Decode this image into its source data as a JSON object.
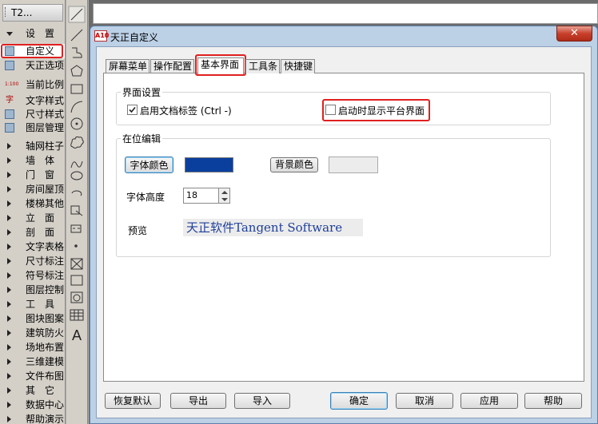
{
  "left_panel": {
    "title": "T2...",
    "items": [
      {
        "label": "设　置",
        "kind": "arrow-down",
        "icon": "expand-arrow-icon"
      },
      {
        "label": "自定义",
        "kind": "icon",
        "icon": "customize-pen-icon",
        "selected": true
      },
      {
        "label": "天正选项",
        "kind": "icon",
        "icon": "options-icon"
      },
      {
        "label": "当前比例",
        "kind": "icon",
        "icon": "scale-1-100-icon",
        "icon_text": "1:100"
      },
      {
        "label": "文字样式",
        "kind": "icon",
        "icon": "text-style-icon",
        "icon_text": "字"
      },
      {
        "label": "尺寸样式",
        "kind": "icon",
        "icon": "dimension-style-icon"
      },
      {
        "label": "图层管理",
        "kind": "icon",
        "icon": "layer-manager-icon"
      },
      {
        "label": "轴网柱子",
        "kind": "arrow"
      },
      {
        "label": "墙　体",
        "kind": "arrow"
      },
      {
        "label": "门　窗",
        "kind": "arrow"
      },
      {
        "label": "房间屋顶",
        "kind": "arrow"
      },
      {
        "label": "楼梯其他",
        "kind": "arrow"
      },
      {
        "label": "立　面",
        "kind": "arrow"
      },
      {
        "label": "剖　面",
        "kind": "arrow"
      },
      {
        "label": "文字表格",
        "kind": "arrow"
      },
      {
        "label": "尺寸标注",
        "kind": "arrow"
      },
      {
        "label": "符号标注",
        "kind": "arrow"
      },
      {
        "label": "图层控制",
        "kind": "arrow"
      },
      {
        "label": "工　具",
        "kind": "arrow"
      },
      {
        "label": "图块图案",
        "kind": "arrow"
      },
      {
        "label": "建筑防火",
        "kind": "arrow"
      },
      {
        "label": "场地布置",
        "kind": "arrow"
      },
      {
        "label": "三维建模",
        "kind": "arrow"
      },
      {
        "label": "文件布图",
        "kind": "arrow"
      },
      {
        "label": "其　它",
        "kind": "arrow"
      },
      {
        "label": "数据中心",
        "kind": "arrow"
      },
      {
        "label": "帮助演示",
        "kind": "arrow"
      }
    ]
  },
  "toolstrip": {
    "tools": [
      "line-tool-icon",
      "construction-line-icon",
      "polyline-icon",
      "polygon-icon",
      "rectangle-icon",
      "arc-icon",
      "circle-icon",
      "revision-cloud-icon",
      "spline-icon",
      "ellipse-icon",
      "ellipse-arc-icon",
      "insert-block-icon",
      "make-block-icon",
      "point-icon",
      "hatch-icon",
      "gradient-icon",
      "region-icon",
      "table-icon",
      "multiline-text-icon"
    ],
    "text_tool_label": "A"
  },
  "dialog": {
    "logo_text": "A10",
    "title": "天正自定义",
    "close_label": "✕",
    "tabs": [
      "屏幕菜单",
      "操作配置",
      "基本界面",
      "工具条",
      "快捷键"
    ],
    "active_tab": "基本界面",
    "interface_group": {
      "title": "界面设置",
      "doc_tab_label": "启用文档标签 (Ctrl -)",
      "doc_tab_checked": true,
      "startup_label": "启动时显示平台界面",
      "startup_checked": false
    },
    "inplace_group": {
      "title": "在位编辑",
      "font_color_button": "字体颜色",
      "font_color": "#0a3f9e",
      "bg_color_button": "背景颜色",
      "bg_color": "#ececec",
      "font_height_label": "字体高度",
      "font_height_value": "18",
      "preview_label": "预览",
      "preview_text": "天正软件Tangent Software"
    },
    "buttons": {
      "restore": "恢复默认",
      "export": "导出",
      "import": "导入",
      "ok": "确定",
      "cancel": "取消",
      "apply": "应用",
      "help": "帮助"
    }
  }
}
